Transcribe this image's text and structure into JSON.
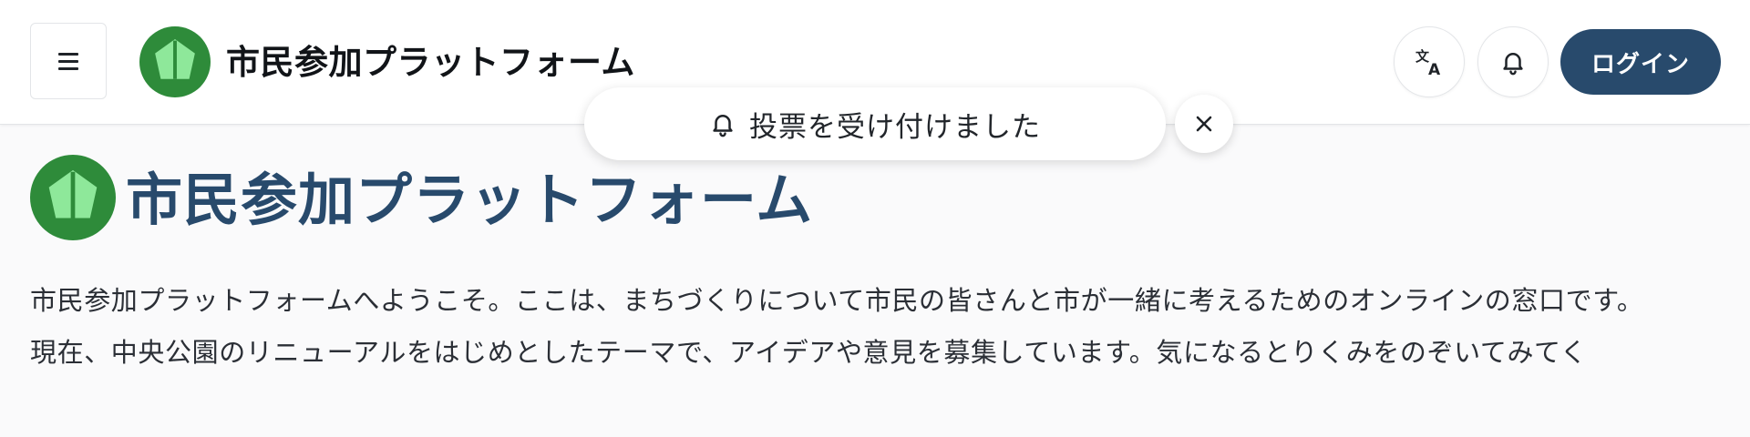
{
  "header": {
    "brand_title": "市民参加プラットフォーム",
    "login_label": "ログイン",
    "icons": {
      "menu": "hamburger-menu-icon",
      "translate": "translate-icon",
      "notifications": "bell-icon"
    }
  },
  "toast": {
    "message": "投票を受け付けました",
    "icon": "bell-icon",
    "close_icon": "close-icon"
  },
  "main": {
    "title": "市民参加プラットフォーム",
    "paragraphs": [
      "市民参加プラットフォームへようこそ。ここは、まちづくりについて市民の皆さんと市が一緒に考えるためのオンラインの窓口です。",
      "現在、中央公園のリニューアルをはじめとしたテーマで、アイデアや意見を募集しています。気になるとりくみをのぞいてみてく"
    ]
  },
  "colors": {
    "brand_navy": "#284a6c",
    "logo_green": "#2e8b3a",
    "logo_leaf": "#8ee89a",
    "background": "#fafafb"
  }
}
